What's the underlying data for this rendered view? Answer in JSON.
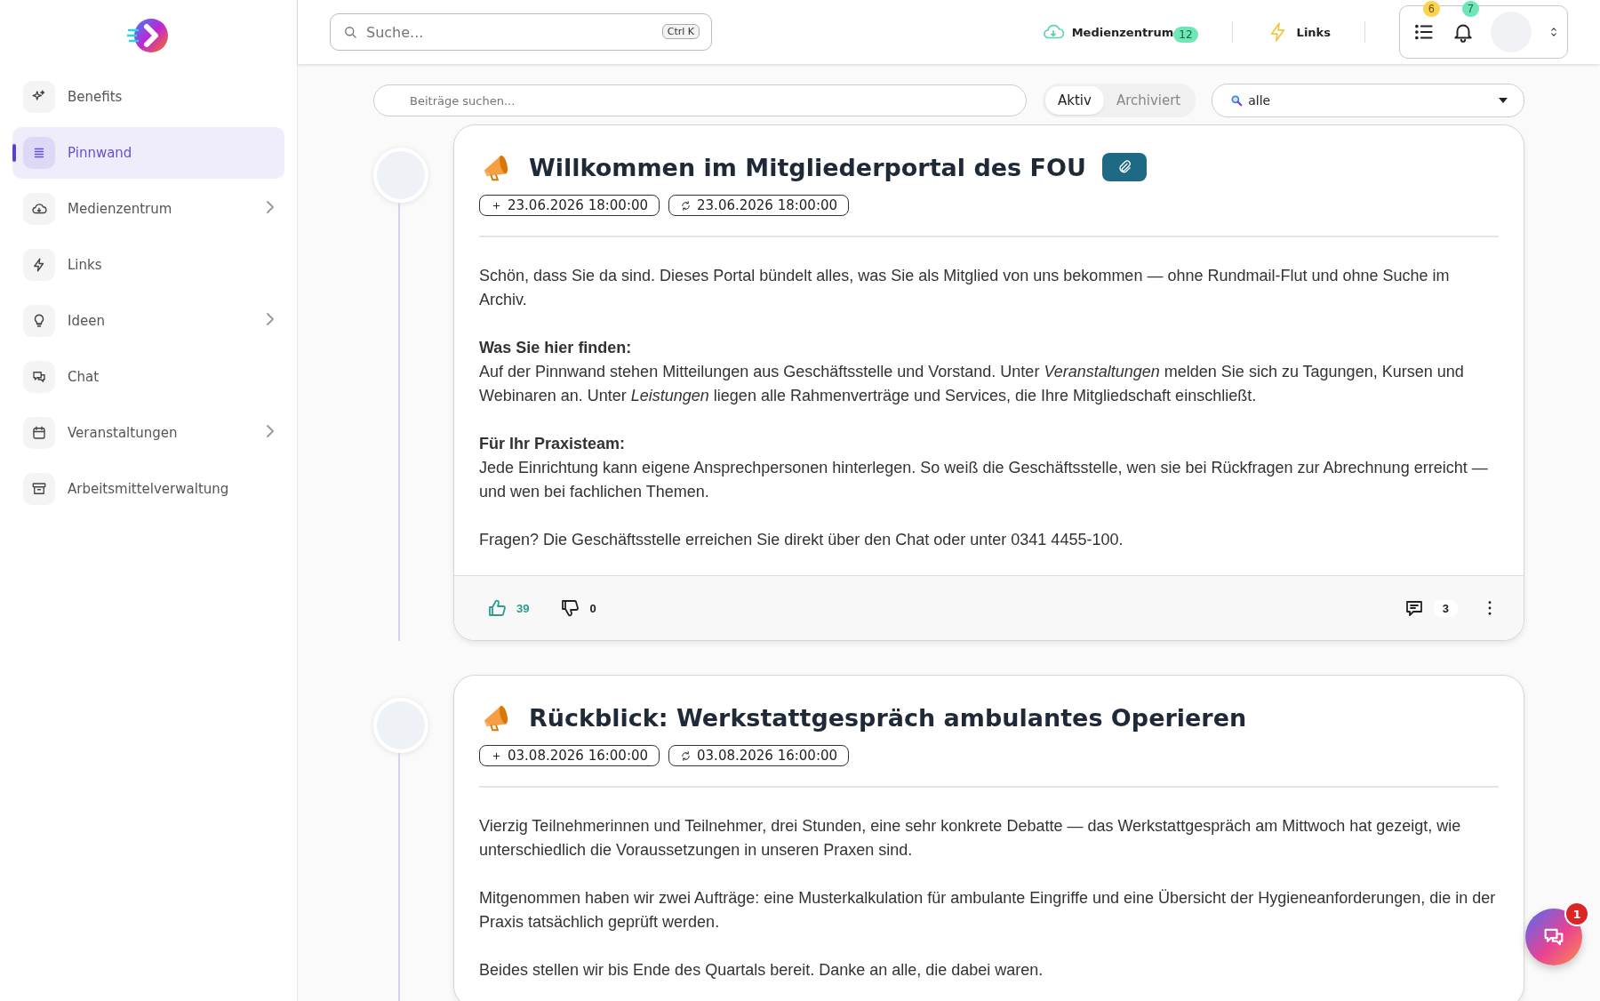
{
  "sidebar": {
    "items": [
      {
        "label": "Benefits",
        "selected": false,
        "has_children": false
      },
      {
        "label": "Pinnwand",
        "selected": true,
        "has_children": false
      },
      {
        "label": "Medienzentrum",
        "selected": false,
        "has_children": true
      },
      {
        "label": "Links",
        "selected": false,
        "has_children": false
      },
      {
        "label": "Ideen",
        "selected": false,
        "has_children": true
      },
      {
        "label": "Chat",
        "selected": false,
        "has_children": false
      },
      {
        "label": "Veranstaltungen",
        "selected": false,
        "has_children": true
      },
      {
        "label": "Arbeitsmittelverwaltung",
        "selected": false,
        "has_children": false
      }
    ]
  },
  "header": {
    "search": {
      "placeholder": "Suche...",
      "shortcut": "Ctrl K"
    },
    "links": [
      {
        "label": "Medienzentrum",
        "badge": "12"
      },
      {
        "label": "Links"
      }
    ],
    "tasks_badge": "6",
    "notifications_badge": "7"
  },
  "filters": {
    "search": {
      "placeholder": "Beiträge suchen..."
    },
    "tabs": [
      {
        "label": "Aktiv",
        "selected": true
      },
      {
        "label": "Archiviert",
        "selected": false
      }
    ],
    "category": {
      "value": "alle"
    }
  },
  "posts": [
    {
      "title": "Willkommen im Mitgliederportal des FOU",
      "has_attachment": true,
      "created": "23.06.2026 18:00:00",
      "updated": "23.06.2026 18:00:00",
      "paragraphs": [
        {
          "text": "Schön, dass Sie da sind. Dieses Portal bündelt alles, was Sie als Mitglied von uns bekommen — ohne Rundmail-Flut und ohne Suche im Archiv."
        },
        {
          "heading": "Was Sie hier finden:",
          "text": "Auf der Pinnwand stehen Mitteilungen aus Geschäftsstelle und Vorstand. Unter *Veranstaltungen* melden Sie sich zu Tagungen, Kursen und Webinaren an. Unter *Leistungen* liegen alle Rahmenverträge und Services, die Ihre Mitgliedschaft einschließt."
        },
        {
          "heading": "Für Ihr Praxisteam:",
          "text": "Jede Einrichtung kann eigene Ansprechpersonen hinterlegen. So weiß die Geschäftsstelle, wen sie bei Rückfragen zur Abrechnung erreicht — und wen bei fachlichen Themen."
        },
        {
          "text": "Fragen? Die Geschäftsstelle erreichen Sie direkt über den Chat oder unter 0341 4455-100."
        }
      ],
      "footer": {
        "likes": "39",
        "liked": true,
        "dislikes": "0",
        "comments": "3"
      }
    },
    {
      "title": "Rückblick: Werkstattgespräch ambulantes Operieren",
      "has_attachment": false,
      "created": "03.08.2026 16:00:00",
      "updated": "03.08.2026 16:00:00",
      "paragraphs": [
        {
          "text": "Vierzig Teilnehmerinnen und Teilnehmer, drei Stunden, eine sehr konkrete Debatte — das Werkstattgespräch am Mittwoch hat gezeigt, wie unterschiedlich die Voraussetzungen in unseren Praxen sind."
        },
        {
          "text": "Mitgenommen haben wir zwei Aufträge: eine Musterkalkulation für ambulante Eingriffe und eine Übersicht der Hygieneanforderungen, die in der Praxis tatsächlich geprüft werden."
        },
        {
          "text": "Beides stellen wir bis Ende des Quartals bereit. Danke an alle, die dabei waren."
        }
      ]
    }
  ],
  "chat_button": {
    "badge": "1"
  }
}
